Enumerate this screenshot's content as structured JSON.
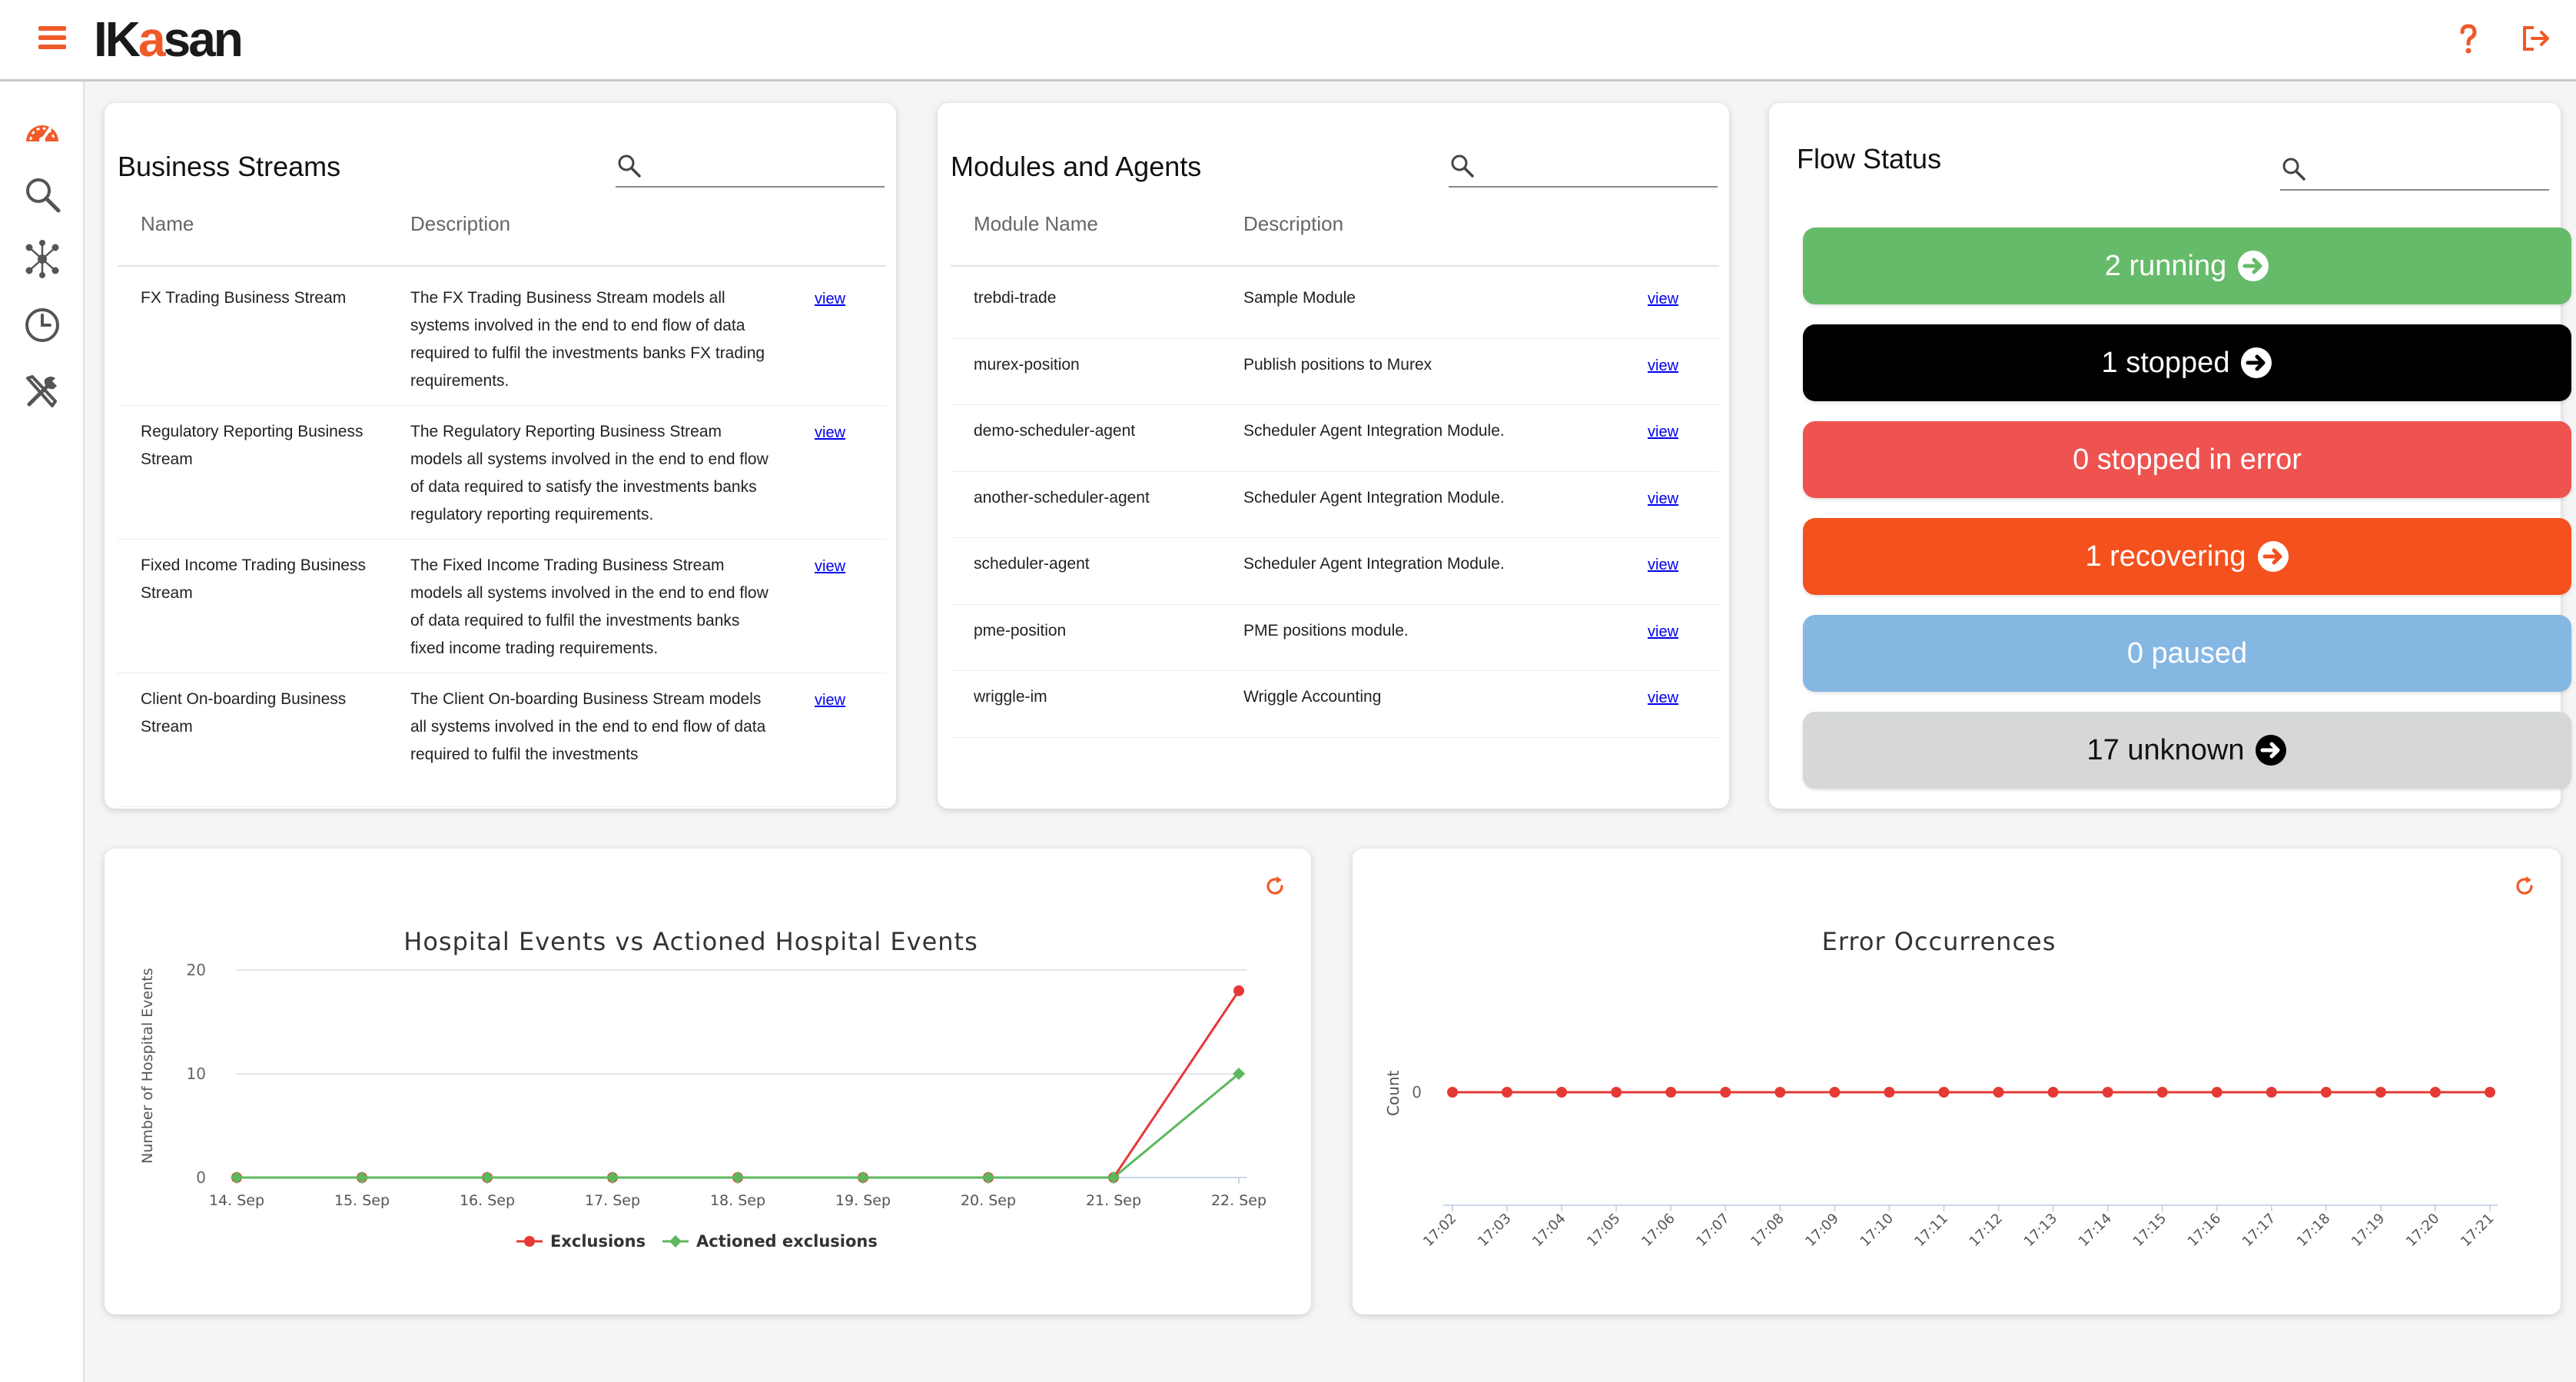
{
  "header": {
    "logo_prefix": "IK",
    "logo_accent": "a",
    "logo_suffix": "san"
  },
  "icons": {
    "menu": "hamburger-menu-icon",
    "help": "question-mark-icon",
    "logout": "logout-icon",
    "rail": [
      "dashboard-icon",
      "search-icon",
      "topology-icon",
      "clock-icon",
      "tools-icon"
    ]
  },
  "colors": {
    "brand": "#f05a28",
    "running": "#66bb6a",
    "stopped": "#000000",
    "error": "#ef5350",
    "recovering": "#f4511e",
    "paused": "#85b7e3",
    "unknown": "#d5d8d6",
    "exclusions": "#e53935",
    "actioned": "#5cb85c"
  },
  "business_streams": {
    "title": "Business Streams",
    "search_placeholder": "",
    "col_name": "Name",
    "col_description": "Description",
    "rows": [
      {
        "name": "FX Trading Business Stream",
        "description": "The FX Trading Business Stream models all systems involved in the end to end flow of data required to fulfil the investments banks FX trading requirements.",
        "link": "view"
      },
      {
        "name": "Regulatory Reporting Business Stream",
        "description": "The Regulatory Reporting Business Stream models all systems involved in the end to end flow of data required to satisfy the investments banks regulatory reporting requirements.",
        "link": "view"
      },
      {
        "name": "Fixed Income Trading Business Stream",
        "description": "The Fixed Income Trading Business Stream models all systems involved in the end to end flow of data required to fulfil the investments banks fixed income trading requirements.",
        "link": "view"
      },
      {
        "name": "Client On-boarding Business Stream",
        "description": "The Client On-boarding Business Stream models all systems involved in the end to end flow of data required to fulfil the investments",
        "link": "view"
      }
    ]
  },
  "modules": {
    "title": "Modules and Agents",
    "search_placeholder": "",
    "col_name": "Module Name",
    "col_description": "Description",
    "rows": [
      {
        "name": "trebdi-trade",
        "description": "Sample Module",
        "link": "view"
      },
      {
        "name": "murex-position",
        "description": "Publish positions to Murex",
        "link": "view"
      },
      {
        "name": "demo-scheduler-agent",
        "description": "Scheduler Agent Integration Module.",
        "link": "view"
      },
      {
        "name": "another-scheduler-agent",
        "description": "Scheduler Agent Integration Module.",
        "link": "view"
      },
      {
        "name": "scheduler-agent",
        "description": "Scheduler Agent Integration Module.",
        "link": "view"
      },
      {
        "name": "pme-position",
        "description": "PME positions module.",
        "link": "view"
      },
      {
        "name": "wriggle-im",
        "description": "Wriggle Accounting",
        "link": "view"
      }
    ]
  },
  "flow_status": {
    "title": "Flow Status",
    "search_placeholder": "",
    "items": [
      {
        "label": "2 running",
        "arrow": true
      },
      {
        "label": "1 stopped",
        "arrow": true
      },
      {
        "label": "0 stopped in error",
        "arrow": false
      },
      {
        "label": "1 recovering",
        "arrow": true
      },
      {
        "label": "0 paused",
        "arrow": false
      },
      {
        "label": "17 unknown",
        "arrow": true
      }
    ]
  },
  "chart_data": [
    {
      "type": "line",
      "title": "Hospital Events vs Actioned Hospital Events",
      "ylabel": "Number of Hospital Events",
      "xlabel": "",
      "ylim": [
        0,
        20
      ],
      "yticks": [
        0,
        10,
        20
      ],
      "grid": true,
      "legend": "bottom-center",
      "categories": [
        "14. Sep",
        "15. Sep",
        "16. Sep",
        "17. Sep",
        "18. Sep",
        "19. Sep",
        "20. Sep",
        "21. Sep",
        "22. Sep"
      ],
      "series": [
        {
          "name": "Exclusions",
          "values": [
            0,
            0,
            0,
            0,
            0,
            0,
            0,
            0,
            18
          ]
        },
        {
          "name": "Actioned exclusions",
          "values": [
            0,
            0,
            0,
            0,
            0,
            0,
            0,
            0,
            10
          ]
        }
      ]
    },
    {
      "type": "line",
      "title": "Error Occurrences",
      "ylabel": "Count",
      "xlabel": "",
      "yticks": [
        0
      ],
      "grid": false,
      "categories": [
        "17:02",
        "17:03",
        "17:04",
        "17:05",
        "17:06",
        "17:07",
        "17:08",
        "17:09",
        "17:10",
        "17:11",
        "17:12",
        "17:13",
        "17:14",
        "17:15",
        "17:16",
        "17:17",
        "17:18",
        "17:19",
        "17:20",
        "17:21"
      ],
      "series": [
        {
          "values": [
            0,
            0,
            0,
            0,
            0,
            0,
            0,
            0,
            0,
            0,
            0,
            0,
            0,
            0,
            0,
            0,
            0,
            0,
            0,
            0
          ]
        }
      ]
    }
  ]
}
